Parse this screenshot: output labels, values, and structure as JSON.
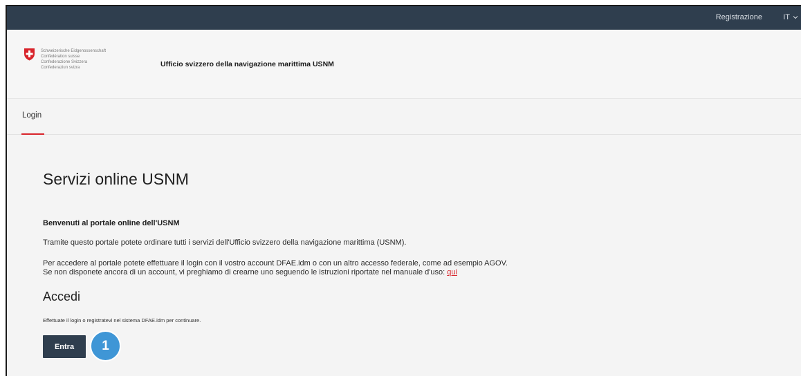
{
  "topbar": {
    "register_label": "Registrazione",
    "language": "IT",
    "language_icon": "chevron-down-icon"
  },
  "header": {
    "confederation_lines": [
      "Schweizerische Eidgenossenschaft",
      "Confédération suisse",
      "Confederazione Svizzera",
      "Confederaziun svizra"
    ],
    "office_name": "Ufficio svizzero della navigazione marittima USNM"
  },
  "nav": {
    "login_tab": "Login"
  },
  "main": {
    "title": "Servizi online USNM",
    "welcome": "Benvenuti al portale online dell'USNM",
    "intro": "Tramite questo portale potete ordinare tutti i servizi dell'Ufficio svizzero della navigazione marittima (USNM).",
    "access_line1": "Per accedere al portale potete effettuare il login con il vostro account DFAE.idm o con un altro accesso federale, come ad esempio AGOV.",
    "access_line2": "Se non disponete ancora di un account, vi preghiamo di crearne uno seguendo le istruzioni riportate nel manuale d'uso:",
    "manual_link": "qui",
    "access_title": "Accedi",
    "access_hint": "Effettuate il login o registratevi nel sistema DFAE.idm per continuare.",
    "enter_button": "Entra"
  },
  "annotation": {
    "step_number": "1"
  },
  "colors": {
    "topbar": "#2f3e4e",
    "accent_red": "#d8232a",
    "badge_blue": "#3f96d6"
  }
}
